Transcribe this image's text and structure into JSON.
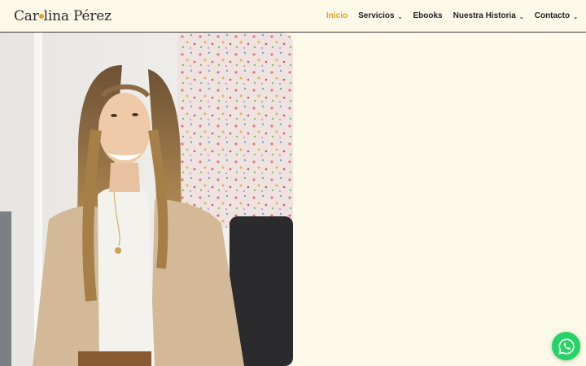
{
  "brand": {
    "name_part1": "Car",
    "name_part2": "lina Pérez"
  },
  "nav": {
    "items": [
      {
        "label": "Inicio",
        "active": true,
        "has_submenu": false
      },
      {
        "label": "Servicios",
        "active": false,
        "has_submenu": true
      },
      {
        "label": "Ebooks",
        "active": false,
        "has_submenu": false
      },
      {
        "label": "Nuestra Historia",
        "active": false,
        "has_submenu": true
      },
      {
        "label": "Contacto",
        "active": false,
        "has_submenu": true
      }
    ],
    "cart_icon": "cart-icon",
    "chevron_icon": "chevron-down-icon"
  },
  "hero": {
    "image_subject": "woman-portrait-photo"
  },
  "whatsapp": {
    "icon": "whatsapp-icon"
  },
  "colors": {
    "background": "#fdf9e8",
    "accent": "#d9a330",
    "whatsapp": "#25d366",
    "text": "#1f1f1f"
  }
}
